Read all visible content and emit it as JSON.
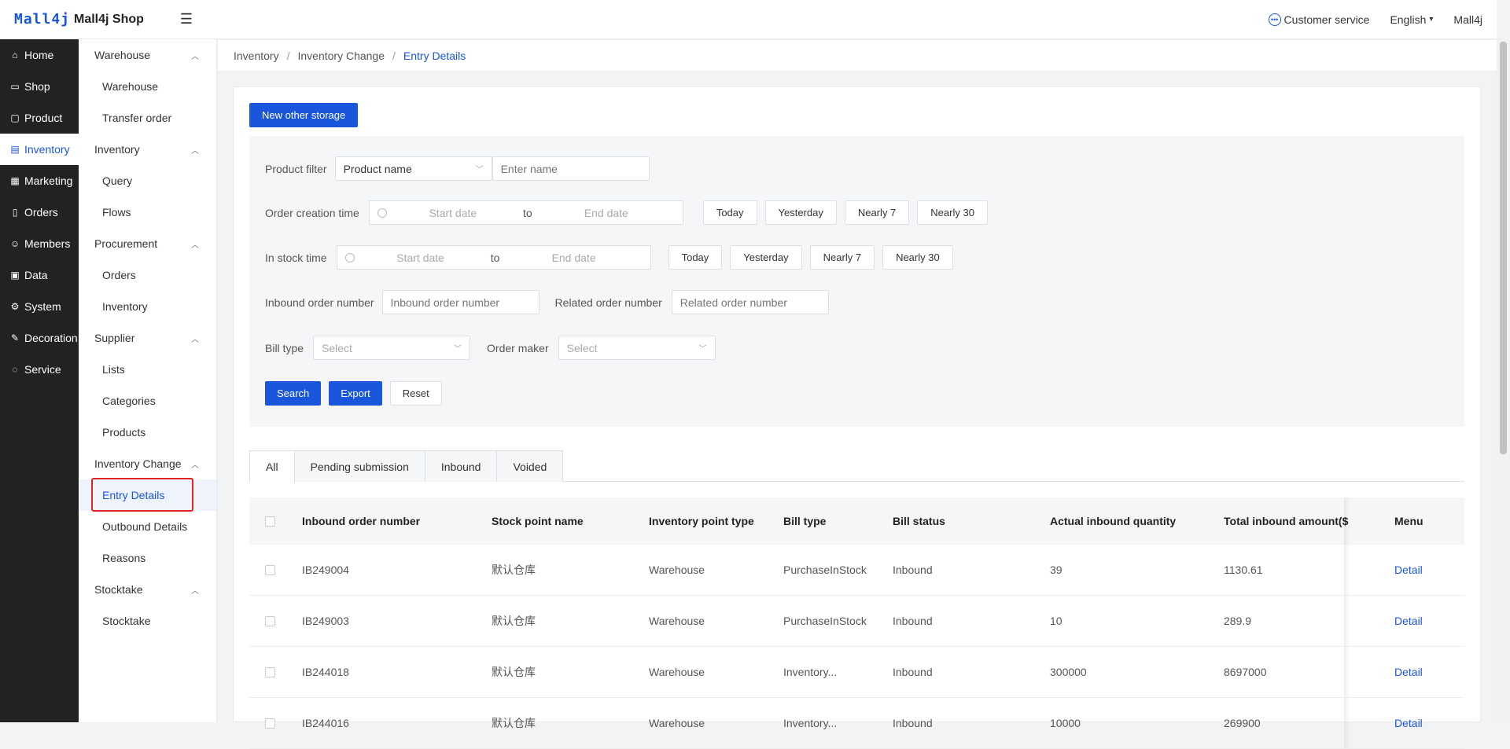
{
  "header": {
    "logo": "Mall4j",
    "shop_name": "Mall4j Shop",
    "customer_service": "Customer service",
    "language": "English",
    "user": "Mall4j"
  },
  "sidebar": {
    "items": [
      {
        "label": "Home",
        "icon": "home-icon"
      },
      {
        "label": "Shop",
        "icon": "shop-icon"
      },
      {
        "label": "Product",
        "icon": "product-icon"
      },
      {
        "label": "Inventory",
        "icon": "inventory-icon",
        "active": true
      },
      {
        "label": "Marketing",
        "icon": "marketing-icon"
      },
      {
        "label": "Orders",
        "icon": "orders-icon"
      },
      {
        "label": "Members",
        "icon": "members-icon"
      },
      {
        "label": "Data",
        "icon": "data-icon"
      },
      {
        "label": "System",
        "icon": "system-icon"
      },
      {
        "label": "Decoration",
        "icon": "decoration-icon"
      },
      {
        "label": "Service",
        "icon": "service-icon"
      }
    ]
  },
  "submenu": {
    "warehouse_group": "Warehouse",
    "warehouse": "Warehouse",
    "transfer_order": "Transfer order",
    "inventory_group": "Inventory",
    "query": "Query",
    "flows": "Flows",
    "procurement_group": "Procurement",
    "proc_orders": "Orders",
    "proc_inventory": "Inventory",
    "supplier_group": "Supplier",
    "lists": "Lists",
    "categories": "Categories",
    "products": "Products",
    "inventory_change_group": "Inventory Change",
    "entry_details": "Entry Details",
    "outbound_details": "Outbound Details",
    "reasons": "Reasons",
    "stocktake_group": "Stocktake",
    "stocktake": "Stocktake"
  },
  "breadcrumb": {
    "level1": "Inventory",
    "level2": "Inventory Change",
    "level3": "Entry Details"
  },
  "actions": {
    "new_other_storage": "New other storage"
  },
  "filters": {
    "product_filter_label": "Product filter",
    "product_filter_type": "Product name",
    "product_name_placeholder": "Enter name",
    "order_creation_time_label": "Order creation time",
    "in_stock_time_label": "In stock time",
    "start_date": "Start date",
    "to": "to",
    "end_date": "End date",
    "today": "Today",
    "yesterday": "Yesterday",
    "nearly7": "Nearly 7",
    "nearly30": "Nearly 30",
    "inbound_order_number_label": "Inbound order number",
    "inbound_order_number_placeholder": "Inbound order number",
    "related_order_number_label": "Related order number",
    "related_order_number_placeholder": "Related order number",
    "bill_type_label": "Bill type",
    "order_maker_label": "Order maker",
    "select_placeholder": "Select",
    "search": "Search",
    "export": "Export",
    "reset": "Reset"
  },
  "tabs": [
    "All",
    "Pending submission",
    "Inbound",
    "Voided"
  ],
  "table": {
    "columns": [
      "Inbound order number",
      "Stock point name",
      "Inventory point type",
      "Bill type",
      "Bill status",
      "Actual inbound quantity",
      "Total inbound amount($",
      "Menu"
    ],
    "rows": [
      {
        "order": "IB249004",
        "stock_point": "默认仓库",
        "point_type": "Warehouse",
        "bill_type": "PurchaseInStock",
        "status": "Inbound",
        "qty": "39",
        "amount": "1130.61",
        "menu": "Detail"
      },
      {
        "order": "IB249003",
        "stock_point": "默认仓库",
        "point_type": "Warehouse",
        "bill_type": "PurchaseInStock",
        "status": "Inbound",
        "qty": "10",
        "amount": "289.9",
        "menu": "Detail"
      },
      {
        "order": "IB244018",
        "stock_point": "默认仓库",
        "point_type": "Warehouse",
        "bill_type": "Inventory...",
        "status": "Inbound",
        "qty": "300000",
        "amount": "8697000",
        "menu": "Detail"
      },
      {
        "order": "IB244016",
        "stock_point": "默认仓库",
        "point_type": "Warehouse",
        "bill_type": "Inventory...",
        "status": "Inbound",
        "qty": "10000",
        "amount": "269900",
        "menu": "Detail"
      }
    ]
  }
}
